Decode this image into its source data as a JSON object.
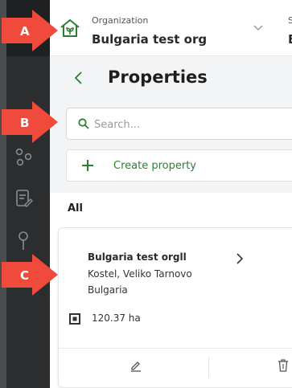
{
  "organization": {
    "label": "Organization",
    "name": "Bulgaria test org",
    "clipped_label": "S",
    "clipped_value": "B"
  },
  "page": {
    "title": "Properties",
    "back_icon": "chevron-left-icon"
  },
  "search": {
    "placeholder": "Search...",
    "value": ""
  },
  "create": {
    "label": "Create property",
    "icon": "plus-icon"
  },
  "section": {
    "title": "All"
  },
  "property_card": {
    "name": "Bulgaria test orgll",
    "address_line1": "Kostel, Veliko Tarnovo",
    "address_line2": "Bulgaria",
    "area": "120.37 ha"
  },
  "sidebar_icons": [
    "nodes-icon",
    "document-edit-icon",
    "pin-icon"
  ],
  "callouts": [
    "A",
    "B",
    "C"
  ],
  "colors": {
    "accent_green": "#2e7d32",
    "sidebar": "#2b2d2f",
    "callout_red": "#f04a3c"
  }
}
